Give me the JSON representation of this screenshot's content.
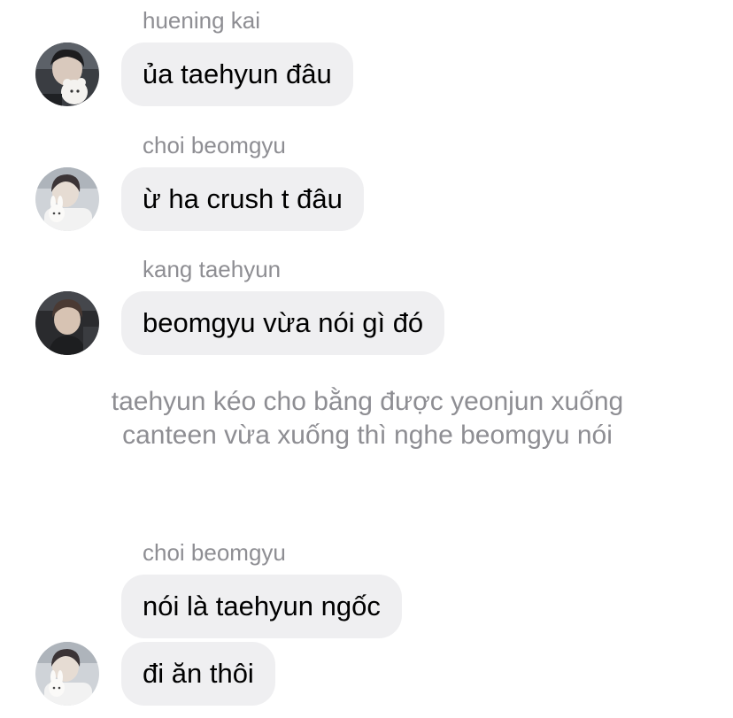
{
  "messages": [
    {
      "sender": "huening kai",
      "text": "ủa taehyun đâu"
    },
    {
      "sender": "choi beomgyu",
      "text": "ừ ha crush t đâu"
    },
    {
      "sender": "kang taehyun",
      "text": "beomgyu vừa nói gì đó"
    }
  ],
  "narration": "taehyun kéo cho bằng được yeonjun xuống canteen vừa xuống thì nghe beomgyu nói",
  "group": {
    "sender": "choi beomgyu",
    "messages": [
      {
        "text": "nói là taehyun ngốc"
      },
      {
        "text": "đi ăn thôi"
      }
    ]
  }
}
